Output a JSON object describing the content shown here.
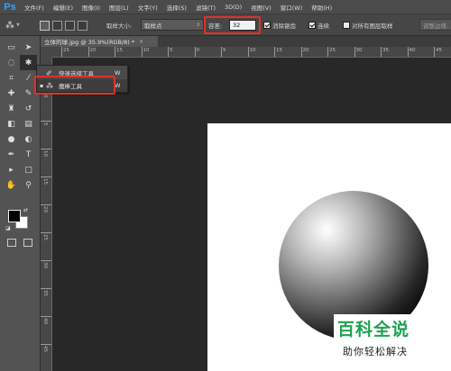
{
  "app": {
    "logo": "Ps"
  },
  "menu": [
    "文件(F)",
    "编辑(E)",
    "图像(I)",
    "图层(L)",
    "文字(Y)",
    "选择(S)",
    "滤镜(T)",
    "3D(D)",
    "视图(V)",
    "窗口(W)",
    "帮助(H)"
  ],
  "options": {
    "tool_icon": "magic-wand-icon",
    "sample_size_label": "取样大小:",
    "sample_size_value": "取样点",
    "tolerance_label": "容差:",
    "tolerance_value": "32",
    "antialias_label": "消除锯齿",
    "antialias_checked": true,
    "contiguous_label": "连续",
    "contiguous_checked": true,
    "all_layers_label": "对所有图层取样",
    "all_layers_checked": false,
    "refine_edge_label": "调整边缘..."
  },
  "document": {
    "tab_title": "立体的球.jpg @ 35.9%(RGB/8) *",
    "close_glyph": "×"
  },
  "rulers": {
    "h_labels": [
      "25",
      "20",
      "15",
      "10",
      "5",
      "0",
      "5",
      "10",
      "15",
      "20",
      "25",
      "30",
      "35",
      "40",
      "45"
    ],
    "v_labels": [
      "5",
      "0",
      "5",
      "10",
      "15",
      "20",
      "25",
      "30",
      "35",
      "40",
      "45"
    ]
  },
  "flyout": {
    "items": [
      {
        "label": "快速选择工具",
        "shortcut": "W",
        "icon": "quick-selection-icon",
        "selected": false
      },
      {
        "label": "魔棒工具",
        "shortcut": "W",
        "icon": "magic-wand-icon",
        "selected": true
      }
    ]
  },
  "colors": {
    "foreground": "#000000",
    "background": "#ffffff",
    "highlight": "#e0312c",
    "watermark_green": "#1fa14f"
  },
  "watermark": {
    "title": "百科全说",
    "subtitle": "助你轻松解决"
  }
}
